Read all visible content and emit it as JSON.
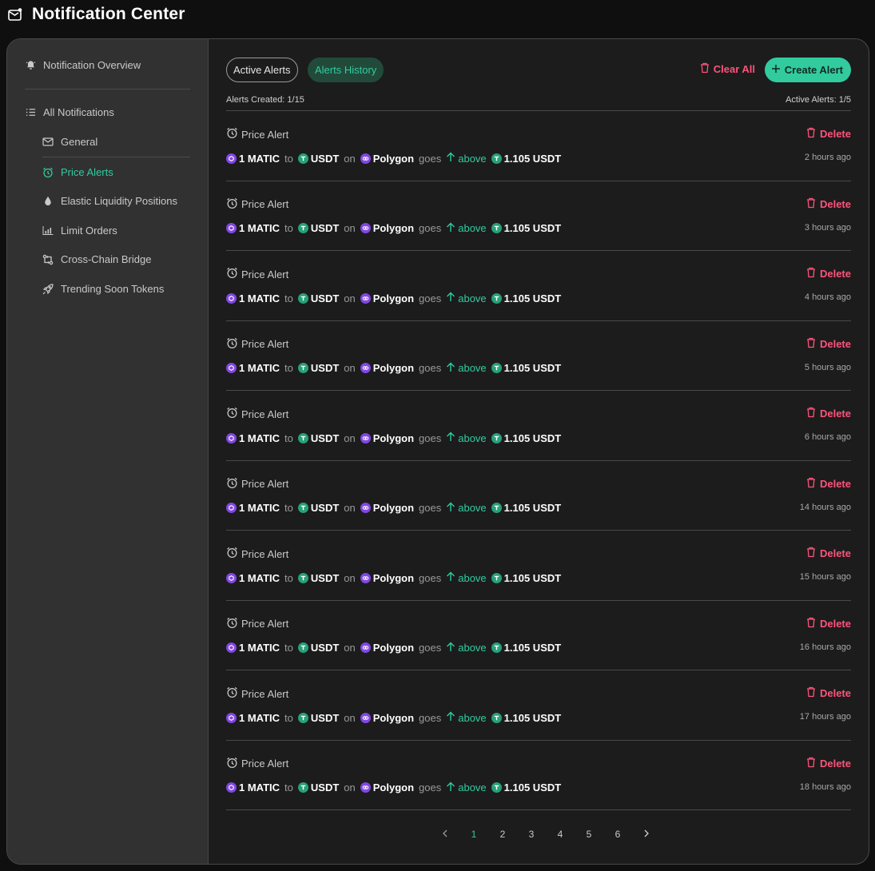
{
  "app": {
    "title": "Notification Center",
    "accent_color": "#31cb9e",
    "danger_color": "#ff537b"
  },
  "sidebar": {
    "overview": {
      "label": "Notification Overview",
      "icon": "bell-icon"
    },
    "all": {
      "label": "All Notifications",
      "icon": "list-icon"
    },
    "items": [
      {
        "label": "General",
        "icon": "mail-icon"
      },
      {
        "label": "Price Alerts",
        "icon": "alarm-clock-icon",
        "active": true
      },
      {
        "label": "Elastic Liquidity Positions",
        "icon": "droplet-icon"
      },
      {
        "label": "Limit Orders",
        "icon": "bar-chart-icon"
      },
      {
        "label": "Cross-Chain Bridge",
        "icon": "bridge-icon"
      },
      {
        "label": "Trending Soon Tokens",
        "icon": "rocket-icon"
      }
    ]
  },
  "toolbar": {
    "tab_active": "Active Alerts",
    "tab_history": "Alerts History",
    "clear_all": "Clear All",
    "create_alert": "Create Alert"
  },
  "stats": {
    "created": "Alerts Created: 1/15",
    "active": "Active Alerts: 1/5"
  },
  "alert_template": {
    "head": "Price Alert",
    "delete": "Delete",
    "from_token": "1 MATIC",
    "to_word": "to",
    "to_token": "USDT",
    "on_word": "on",
    "chain": "Polygon",
    "goes_word": "goes",
    "direction": "above",
    "price": "1.105 USDT"
  },
  "alerts": [
    {
      "time": "2 hours ago"
    },
    {
      "time": "3 hours ago"
    },
    {
      "time": "4 hours ago"
    },
    {
      "time": "5 hours ago"
    },
    {
      "time": "6 hours ago"
    },
    {
      "time": "14 hours ago"
    },
    {
      "time": "15 hours ago"
    },
    {
      "time": "16 hours ago"
    },
    {
      "time": "17 hours ago"
    },
    {
      "time": "18 hours ago"
    }
  ],
  "pagination": {
    "pages": [
      "1",
      "2",
      "3",
      "4",
      "5",
      "6"
    ],
    "current": "1"
  }
}
